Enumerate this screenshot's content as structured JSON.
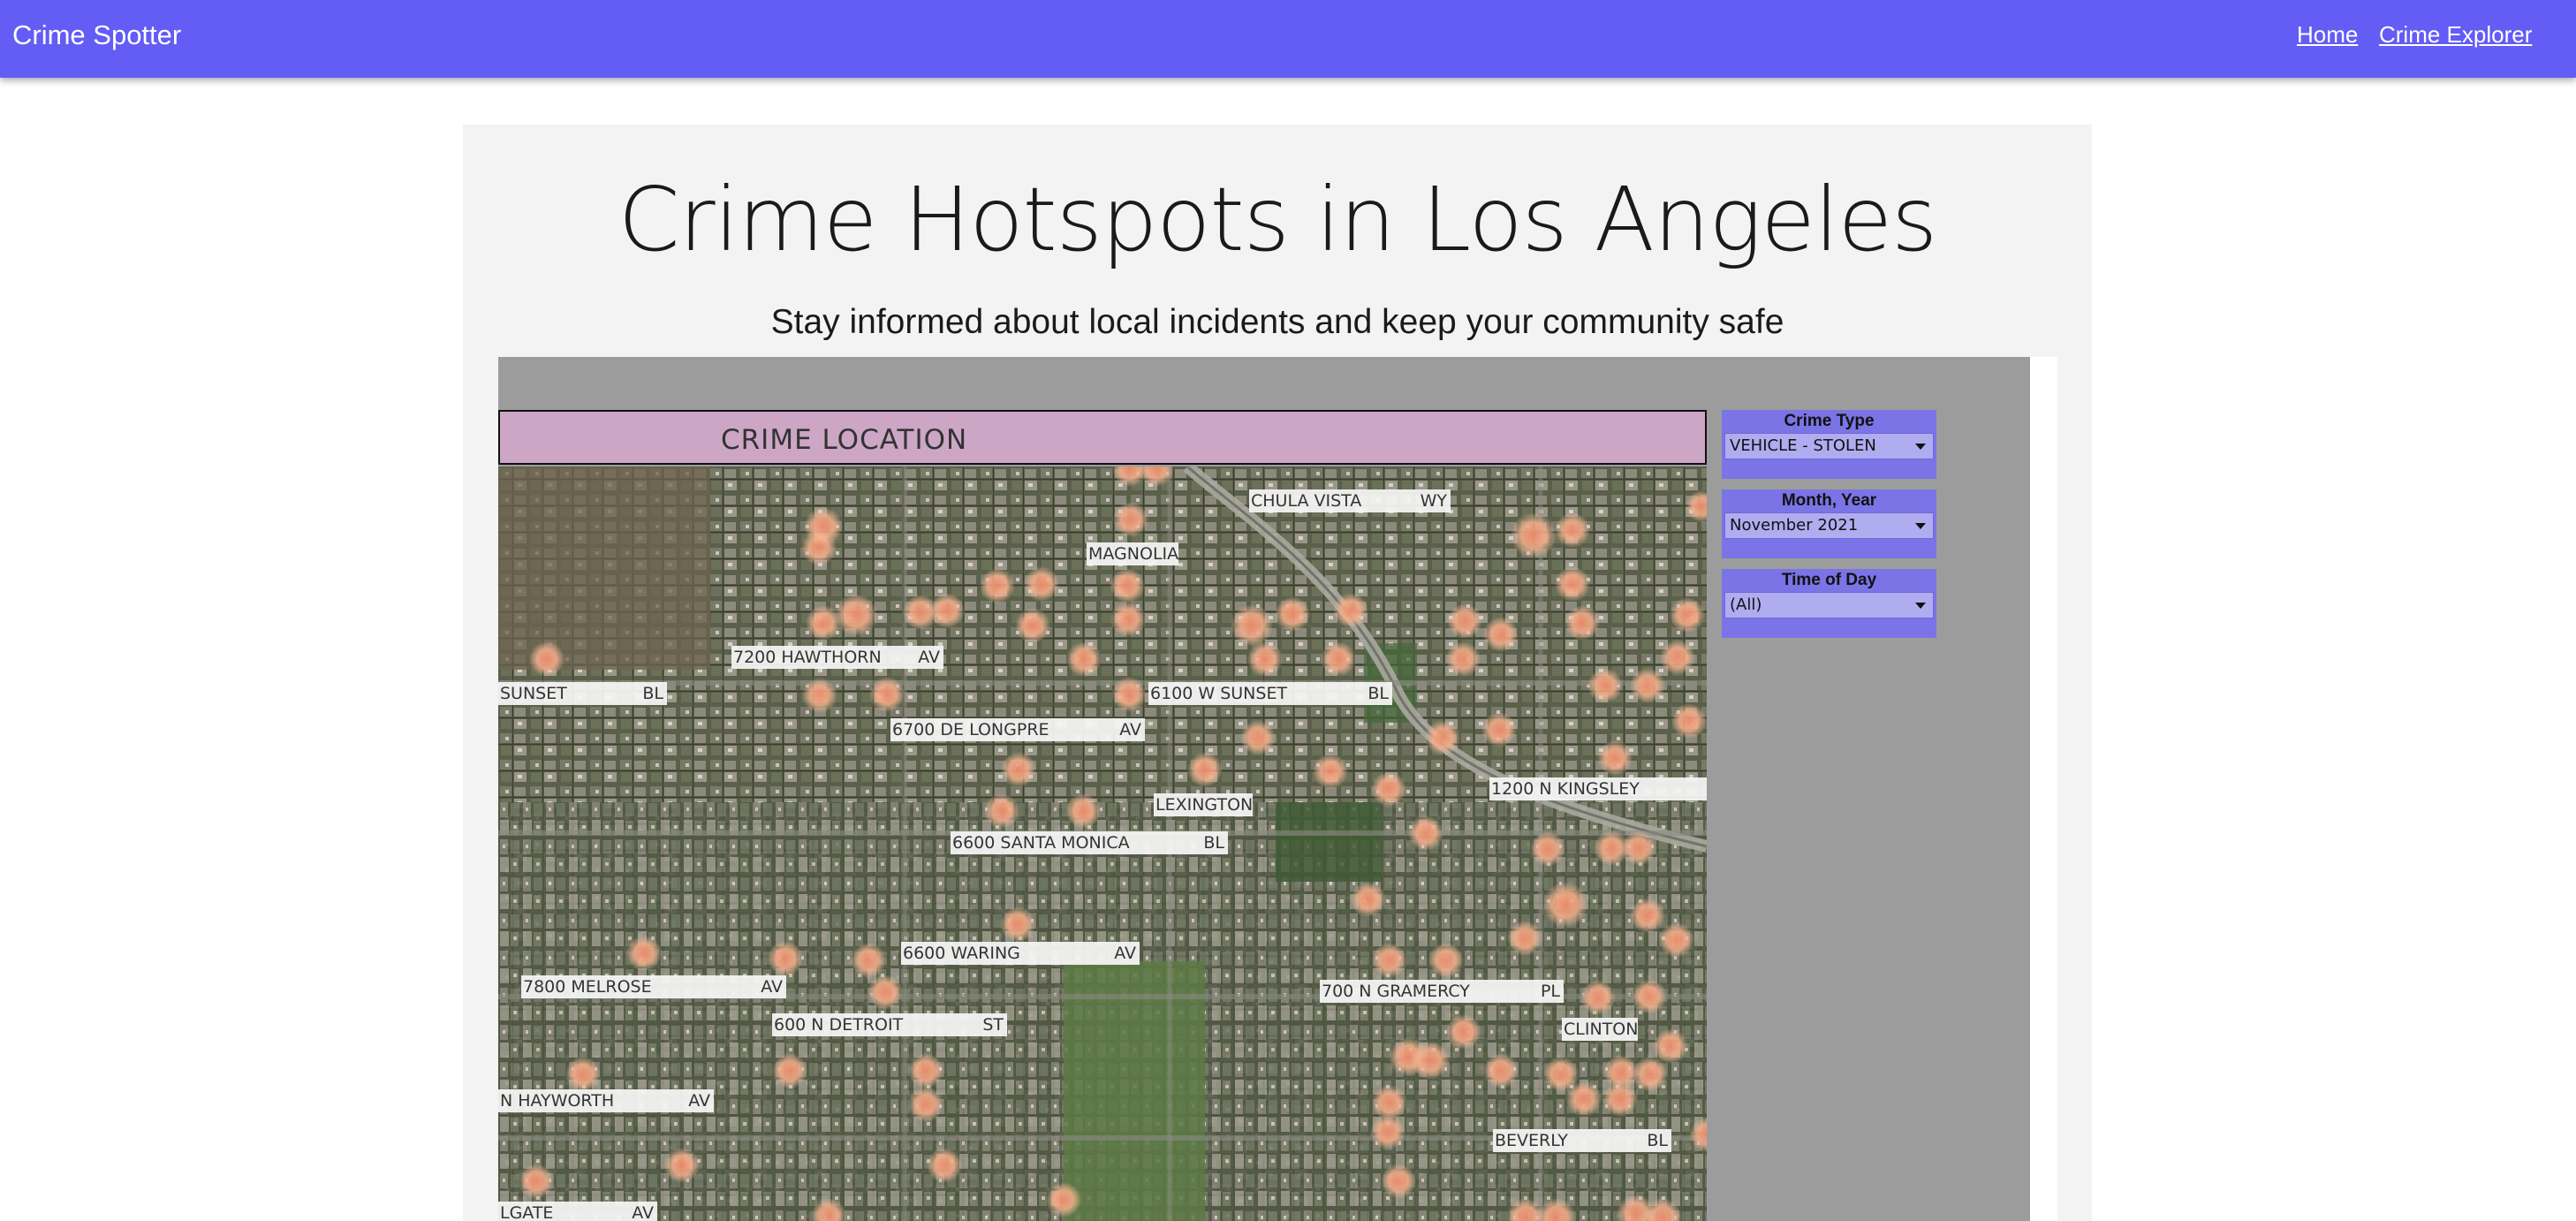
{
  "app": {
    "brand": "Crime Spotter"
  },
  "nav": {
    "home": "Home",
    "explorer": "Crime Explorer"
  },
  "hero": {
    "title": "Crime Hotspots in Los Angeles",
    "subtitle": "Stay informed about local incidents and keep your community safe"
  },
  "viz": {
    "map_title": "CRIME LOCATION",
    "streets": [
      {
        "name": "CHULA VISTA",
        "suffix": "WY"
      },
      {
        "name": "MAGNOLIA",
        "suffix": ""
      },
      {
        "name": "7200   HAWTHORN",
        "suffix": "AV"
      },
      {
        "name": "SUNSET",
        "suffix": "BL"
      },
      {
        "name": "6100 W  SUNSET",
        "suffix": "BL"
      },
      {
        "name": "6700   DE LONGPRE",
        "suffix": "AV"
      },
      {
        "name": "1200 N  KINGSLEY",
        "suffix": ""
      },
      {
        "name": "LEXINGTON",
        "suffix": ""
      },
      {
        "name": "6600   SANTA MONICA",
        "suffix": "BL"
      },
      {
        "name": "6600   WARING",
        "suffix": "AV"
      },
      {
        "name": "7800   MELROSE",
        "suffix": "AV"
      },
      {
        "name": "700 N  GRAMERCY",
        "suffix": "PL"
      },
      {
        "name": "600 N  DETROIT",
        "suffix": "ST"
      },
      {
        "name": "CLINTON",
        "suffix": ""
      },
      {
        "name": "N  HAYWORTH",
        "suffix": "AV"
      },
      {
        "name": "BEVERLY",
        "suffix": "BL"
      },
      {
        "name": "LGATE",
        "suffix": "AV"
      }
    ],
    "filters": [
      {
        "label": "Crime Type",
        "value": "VEHICLE - STOLEN"
      },
      {
        "label": "Month, Year",
        "value": "November 2021"
      },
      {
        "label": "Time of Day",
        "value": "(All)"
      }
    ]
  },
  "colors": {
    "nav_bg": "#635cf5",
    "filter_bg": "#7b74e6",
    "map_header_bg": "#cda6c6",
    "hotspot": "#f4a07c"
  }
}
